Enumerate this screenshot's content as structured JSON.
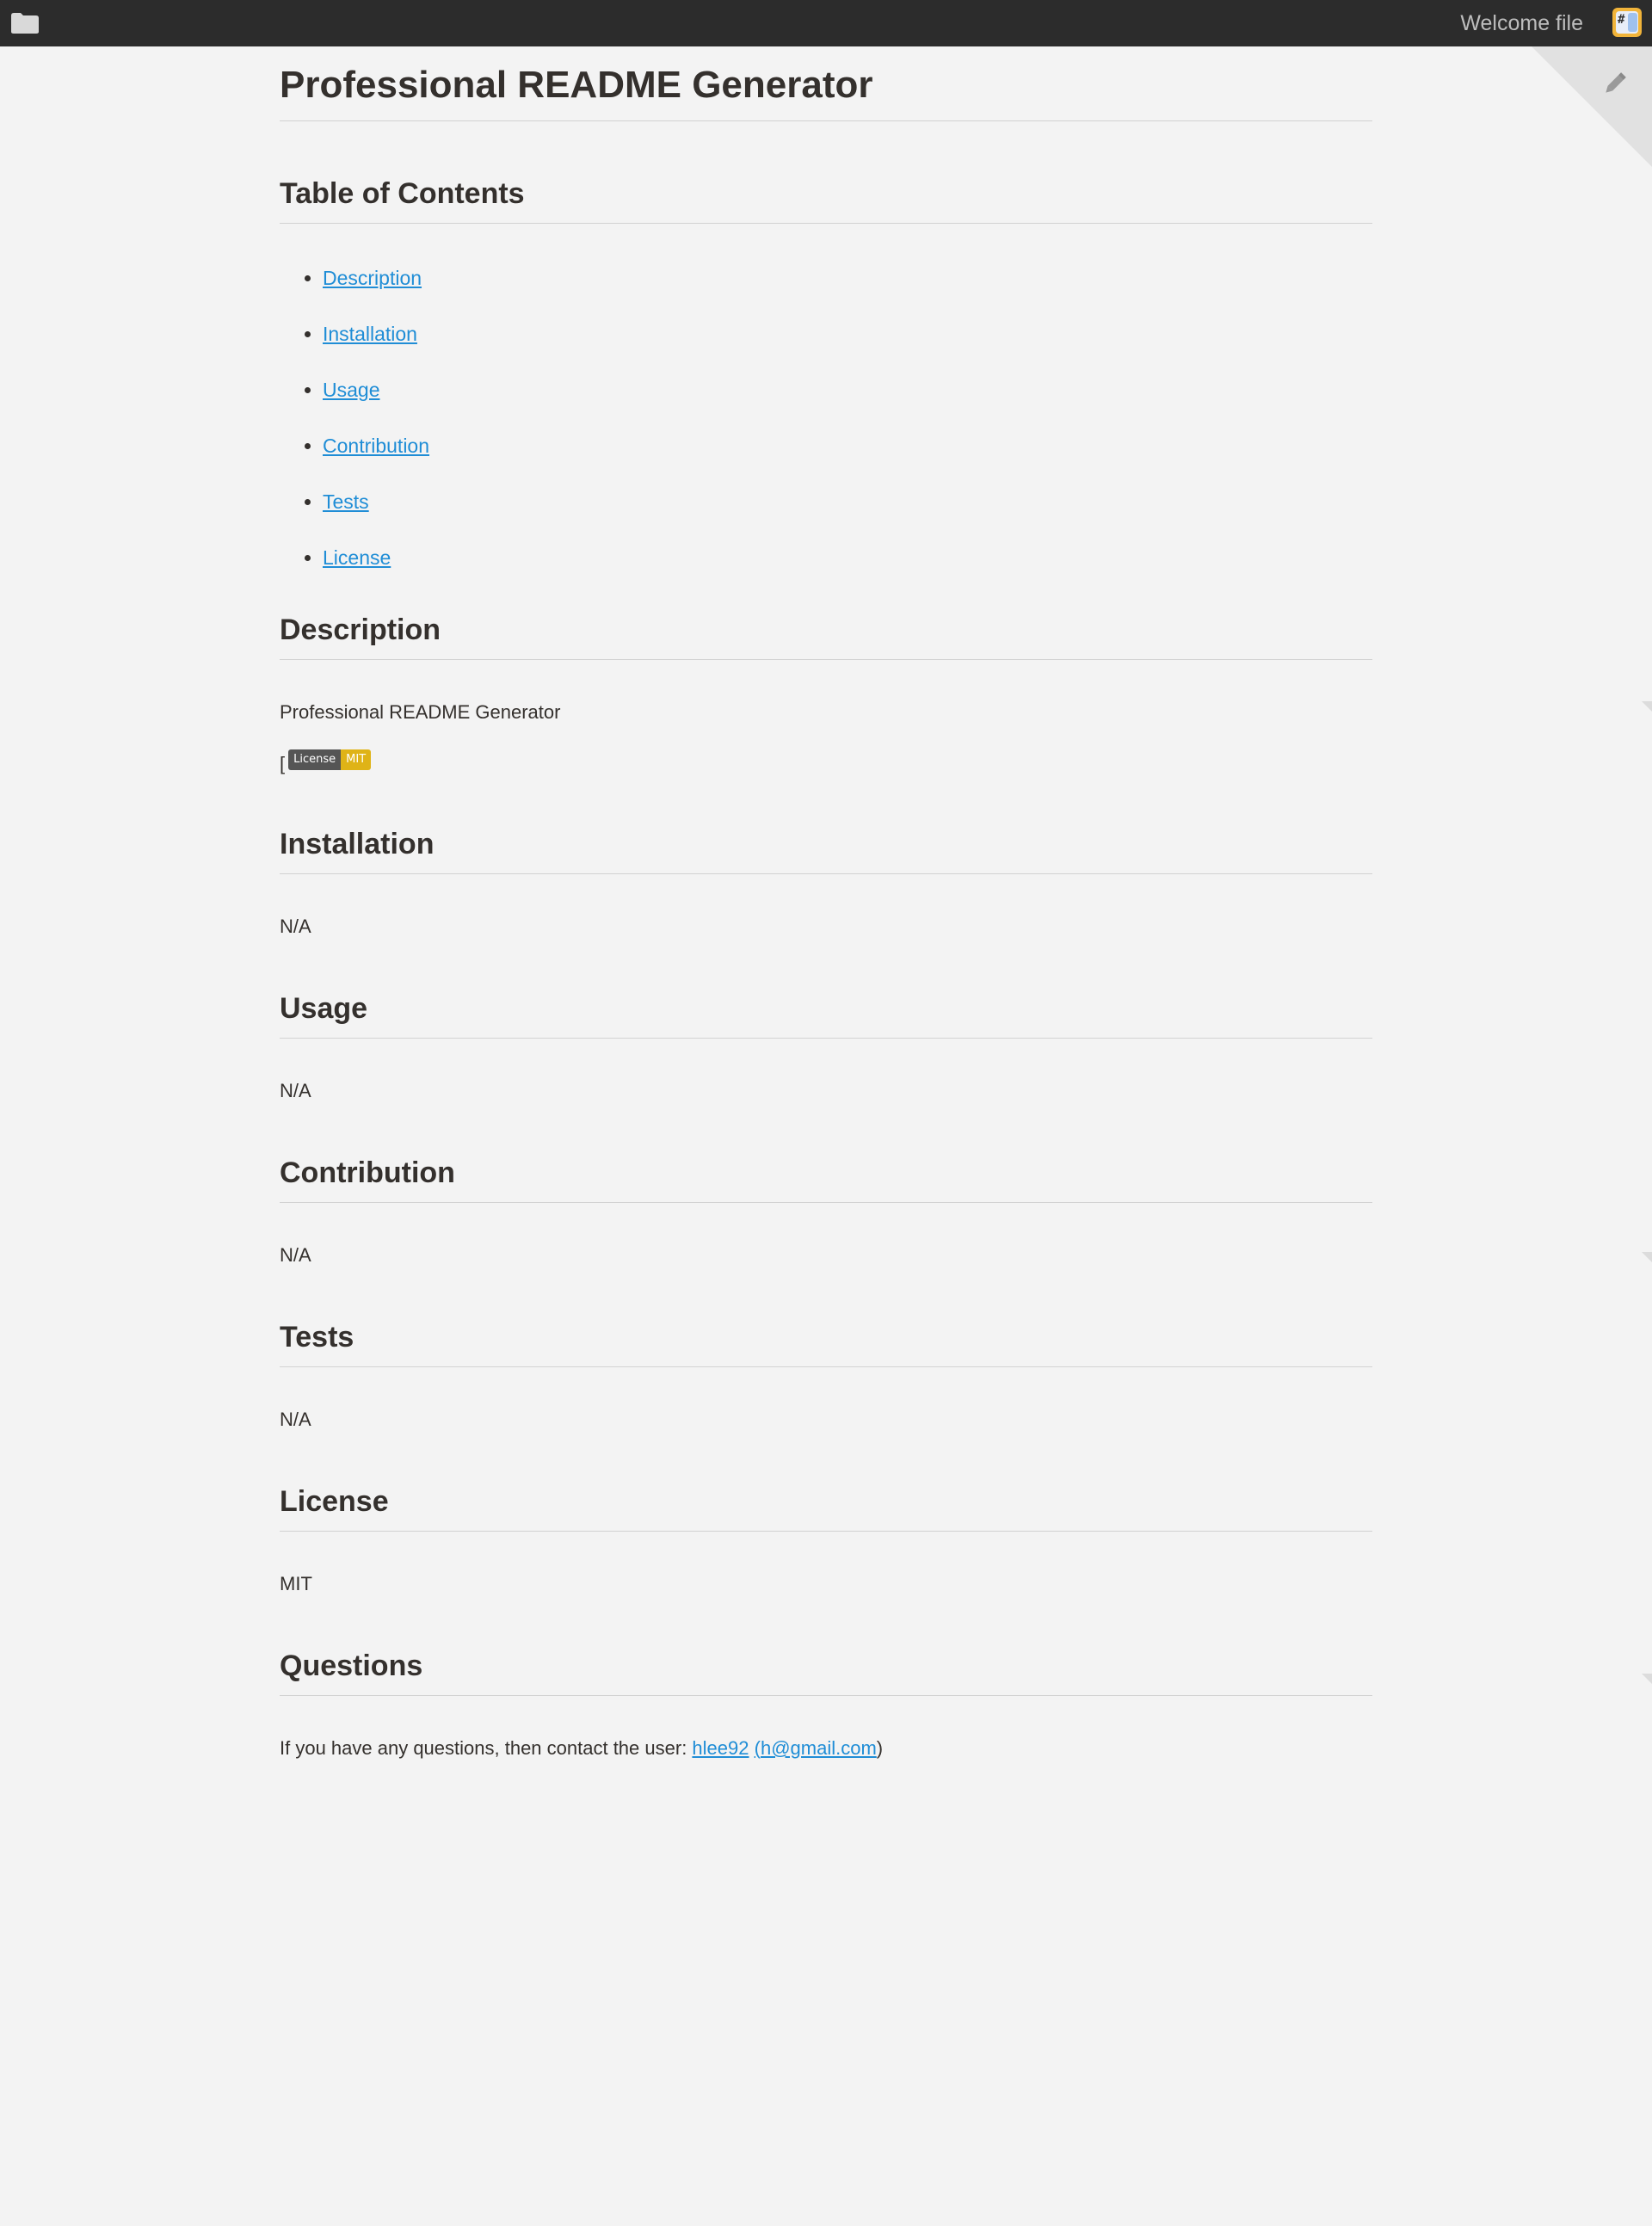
{
  "topbar": {
    "file_title": "Welcome file",
    "folder_icon": "folder-icon",
    "app_icon": "stackedit-icon",
    "background_color": "#2c2c2c"
  },
  "corner": {
    "edit_icon": "pencil-icon"
  },
  "document": {
    "title": "Professional README Generator",
    "toc": {
      "heading": "Table of Contents",
      "items": [
        "Description",
        "Installation",
        "Usage",
        "Contribution",
        "Tests",
        "License"
      ]
    },
    "description": {
      "heading": "Description",
      "text": "Professional README Generator",
      "bracket": "[",
      "badge": {
        "label": "License",
        "value": "MIT",
        "label_color": "#555555",
        "value_color": "#dfb317"
      }
    },
    "installation": {
      "heading": "Installation",
      "text": "N/A"
    },
    "usage": {
      "heading": "Usage",
      "text": "N/A"
    },
    "contribution": {
      "heading": "Contribution",
      "text": "N/A"
    },
    "tests": {
      "heading": "Tests",
      "text": "N/A"
    },
    "license": {
      "heading": "License",
      "text": "MIT"
    },
    "questions": {
      "heading": "Questions",
      "text": "If you have any questions, then contact the user: ",
      "username": "hlee92",
      "email_open": "(",
      "email": "h@gmail.com",
      "close_paren": ")"
    }
  },
  "colors": {
    "page_background": "#f3f3f3",
    "link": "#1f8dd6",
    "text": "#34302d"
  }
}
